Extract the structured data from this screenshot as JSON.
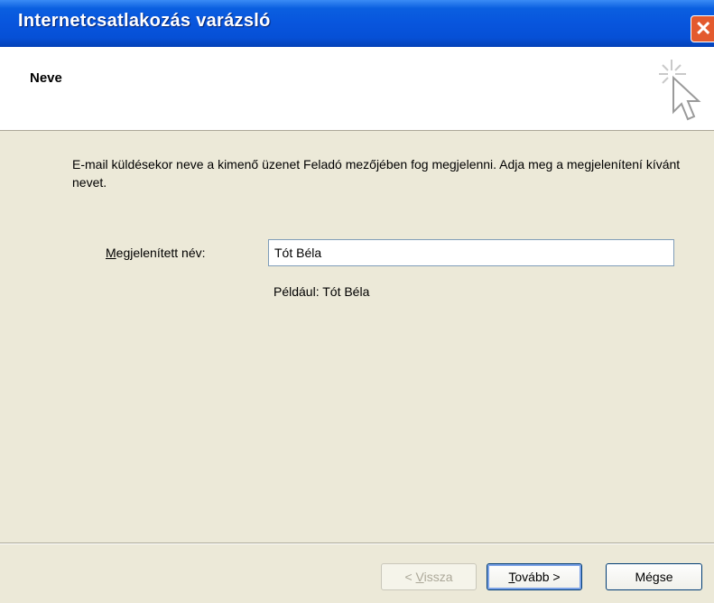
{
  "window": {
    "title": "Internetcsatlakozás varázsló"
  },
  "header": {
    "title": "Neve",
    "icon": "wizard-cursor-icon"
  },
  "content": {
    "description": "E-mail küldésekor neve a kimenő üzenet Feladó mezőjében fog megjelenni. Adja meg a megjelenítení kívánt nevet.",
    "field_label_mnemonic": "M",
    "field_label_rest": "egjelenített név:",
    "display_name_value": "Tót Béla",
    "example": "Például: Tót Béla"
  },
  "buttons": {
    "back_prefix": "< ",
    "back_mnemonic": "V",
    "back_rest": "issza",
    "next_mnemonic": "T",
    "next_rest": "ovább >",
    "cancel": "Mégse"
  },
  "colors": {
    "titlebar": "#0855dd",
    "dialog_bg": "#ece9d8",
    "close": "#e35a2e"
  }
}
